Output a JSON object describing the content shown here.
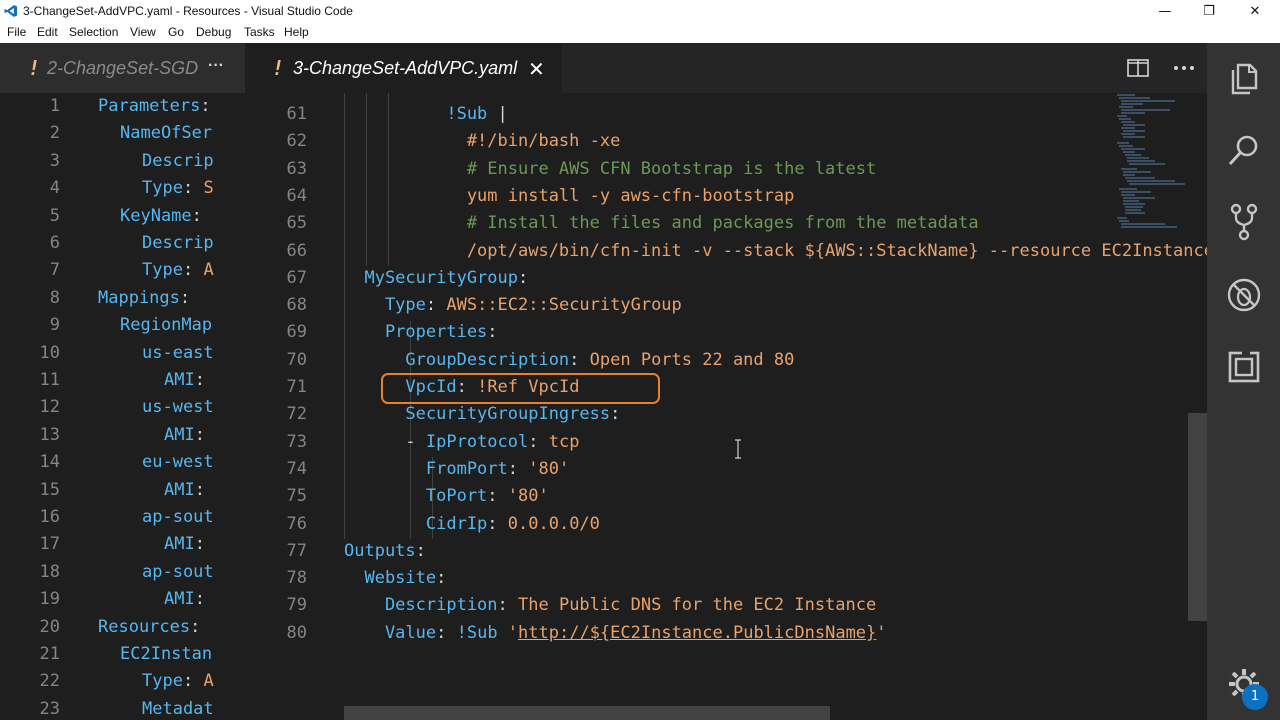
{
  "window": {
    "title": "3-ChangeSet-AddVPC.yaml - Resources - Visual Studio Code",
    "minimize": "—",
    "maximize": "❐",
    "close": "✕"
  },
  "menu": [
    "File",
    "Edit",
    "Selection",
    "View",
    "Go",
    "Debug",
    "Tasks",
    "Help"
  ],
  "left_group": {
    "tab": {
      "modified": "!",
      "label": "2-ChangeSet-SGD",
      "more": "···"
    },
    "lines": [
      {
        "n": "1",
        "indent": 0,
        "text": "Parameters:"
      },
      {
        "n": "2",
        "indent": 1,
        "text": "NameOfSer"
      },
      {
        "n": "3",
        "indent": 2,
        "text": "Descrip"
      },
      {
        "n": "4",
        "indent": 2,
        "text": "Type: S"
      },
      {
        "n": "5",
        "indent": 1,
        "text": "KeyName:"
      },
      {
        "n": "6",
        "indent": 2,
        "text": "Descrip"
      },
      {
        "n": "7",
        "indent": 2,
        "text": "Type: A"
      },
      {
        "n": "8",
        "indent": 0,
        "text": "Mappings:"
      },
      {
        "n": "9",
        "indent": 1,
        "text": "RegionMap"
      },
      {
        "n": "10",
        "indent": 2,
        "text": "us-east"
      },
      {
        "n": "11",
        "indent": 3,
        "text": "AMI:"
      },
      {
        "n": "12",
        "indent": 2,
        "text": "us-west"
      },
      {
        "n": "13",
        "indent": 3,
        "text": "AMI:"
      },
      {
        "n": "14",
        "indent": 2,
        "text": "eu-west"
      },
      {
        "n": "15",
        "indent": 3,
        "text": "AMI:"
      },
      {
        "n": "16",
        "indent": 2,
        "text": "ap-sout"
      },
      {
        "n": "17",
        "indent": 3,
        "text": "AMI:"
      },
      {
        "n": "18",
        "indent": 2,
        "text": "ap-sout"
      },
      {
        "n": "19",
        "indent": 3,
        "text": "AMI:"
      },
      {
        "n": "20",
        "indent": 0,
        "text": "Resources:"
      },
      {
        "n": "21",
        "indent": 1,
        "text": "EC2Instan"
      },
      {
        "n": "22",
        "indent": 2,
        "text": "Type: A"
      },
      {
        "n": "23",
        "indent": 2,
        "text": "Metadat"
      }
    ]
  },
  "right_group": {
    "tab": {
      "modified": "!",
      "label": "3-ChangeSet-AddVPC.yaml",
      "close": "✕"
    },
    "lines": [
      {
        "n": "61",
        "segs": [
          {
            "c": "k",
            "t": "          !Sub "
          },
          {
            "c": "p",
            "t": "|"
          }
        ]
      },
      {
        "n": "62",
        "segs": [
          {
            "c": "v",
            "t": "            #!/bin/bash -xe"
          }
        ]
      },
      {
        "n": "63",
        "segs": [
          {
            "c": "c",
            "t": "            # Ensure AWS CFN Bootstrap is the latest"
          }
        ]
      },
      {
        "n": "64",
        "segs": [
          {
            "c": "v",
            "t": "            yum install -y aws-cfn-bootstrap"
          }
        ]
      },
      {
        "n": "65",
        "segs": [
          {
            "c": "c",
            "t": "            # Install the files and packages from the metadata"
          }
        ]
      },
      {
        "n": "66",
        "segs": [
          {
            "c": "v",
            "t": "            /opt/aws/bin/cfn-init -v --stack ${AWS::StackName} --resource EC2Instance"
          }
        ]
      },
      {
        "n": "67",
        "segs": [
          {
            "c": "k",
            "t": "  MySecurityGroup"
          },
          {
            "c": "p",
            "t": ":"
          }
        ]
      },
      {
        "n": "68",
        "segs": [
          {
            "c": "k",
            "t": "    Type"
          },
          {
            "c": "p",
            "t": ": "
          },
          {
            "c": "v",
            "t": "AWS::EC2::SecurityGroup"
          }
        ]
      },
      {
        "n": "69",
        "segs": [
          {
            "c": "k",
            "t": "    Properties"
          },
          {
            "c": "p",
            "t": ":"
          }
        ]
      },
      {
        "n": "70",
        "segs": [
          {
            "c": "k",
            "t": "      GroupDescription"
          },
          {
            "c": "p",
            "t": ": "
          },
          {
            "c": "v",
            "t": "Open Ports 22 and 80"
          }
        ]
      },
      {
        "n": "71",
        "segs": [
          {
            "c": "k",
            "t": "      VpcId"
          },
          {
            "c": "p",
            "t": ": "
          },
          {
            "c": "v",
            "t": "!Ref VpcId"
          }
        ]
      },
      {
        "n": "72",
        "segs": [
          {
            "c": "k",
            "t": "      SecurityGroupIngress"
          },
          {
            "c": "p",
            "t": ":"
          }
        ]
      },
      {
        "n": "73",
        "segs": [
          {
            "c": "p",
            "t": "      - "
          },
          {
            "c": "k",
            "t": "IpProtocol"
          },
          {
            "c": "p",
            "t": ": "
          },
          {
            "c": "v",
            "t": "tcp"
          }
        ]
      },
      {
        "n": "74",
        "segs": [
          {
            "c": "k",
            "t": "        FromPort"
          },
          {
            "c": "p",
            "t": ": "
          },
          {
            "c": "v",
            "t": "'80'"
          }
        ]
      },
      {
        "n": "75",
        "segs": [
          {
            "c": "k",
            "t": "        ToPort"
          },
          {
            "c": "p",
            "t": ": "
          },
          {
            "c": "v",
            "t": "'80'"
          }
        ]
      },
      {
        "n": "76",
        "segs": [
          {
            "c": "k",
            "t": "        CidrIp"
          },
          {
            "c": "p",
            "t": ": "
          },
          {
            "c": "v",
            "t": "0.0.0.0/0"
          }
        ]
      },
      {
        "n": "77",
        "segs": [
          {
            "c": "k",
            "t": "Outputs"
          },
          {
            "c": "p",
            "t": ":"
          }
        ]
      },
      {
        "n": "78",
        "segs": [
          {
            "c": "k",
            "t": "  Website"
          },
          {
            "c": "p",
            "t": ":"
          }
        ]
      },
      {
        "n": "79",
        "segs": [
          {
            "c": "k",
            "t": "    Description"
          },
          {
            "c": "p",
            "t": ": "
          },
          {
            "c": "v",
            "t": "The Public DNS for the EC2 Instance"
          }
        ]
      },
      {
        "n": "80",
        "segs": [
          {
            "c": "k",
            "t": "    Value"
          },
          {
            "c": "p",
            "t": ": "
          },
          {
            "c": "k",
            "t": "!Sub "
          },
          {
            "c": "v",
            "t": "'"
          },
          {
            "c": "u",
            "t": "http://${EC2Instance.PublicDnsName}"
          },
          {
            "c": "v",
            "t": "'"
          }
        ]
      }
    ]
  },
  "activity_badge": "1",
  "colors": {
    "keyword": "#56b6ef",
    "value": "#e8a26a",
    "comment": "#6a9955",
    "highlight_box": "#e8812f",
    "bang": "#e5c07b"
  }
}
